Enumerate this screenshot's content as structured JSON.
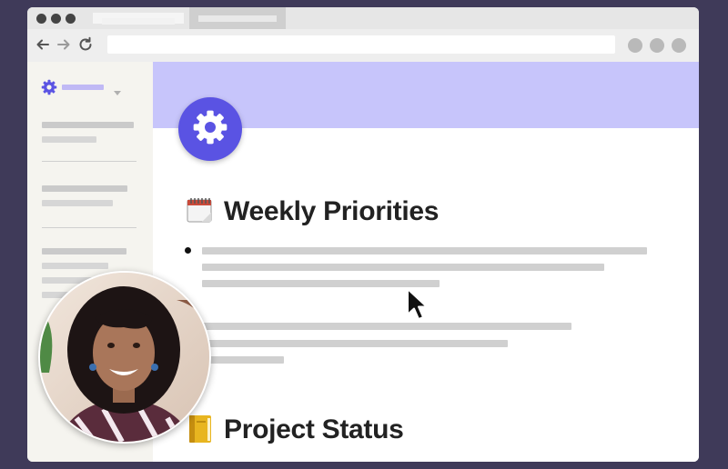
{
  "colors": {
    "background": "#3f3a59",
    "accent": "#5a53e3",
    "banner": "#c7c5fb",
    "sidebar": "#f5f4ef"
  },
  "browser": {
    "nav_icons": [
      "back-arrow-icon",
      "forward-arrow-icon",
      "reload-icon"
    ]
  },
  "sidebar": {
    "workspace_icon": "gear-icon",
    "dropdown_icon": "chevron-down-icon"
  },
  "page": {
    "icon": "gear-icon",
    "sections": [
      {
        "emoji": "spiral-notepad-icon",
        "title": "Weekly Priorities"
      },
      {
        "emoji": "ledger-icon",
        "title": "Project Status"
      }
    ]
  },
  "video_overlay": {
    "type": "presenter-webcam",
    "icon": "avatar"
  }
}
